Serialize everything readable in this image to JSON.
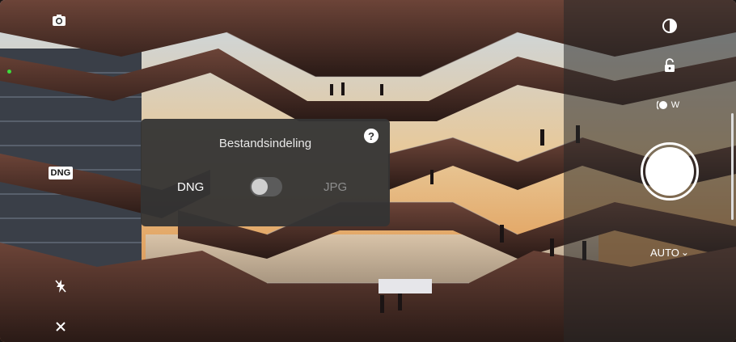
{
  "camera": {
    "raw_format_badge": "DNG",
    "flash_icon": "flash-off-icon",
    "close_icon": "close-icon",
    "switch_camera_icon": "switch-camera-icon",
    "lens_icon": "lens-filter-icon",
    "lock_icon": "unlock-icon",
    "wb_icon": "white-balance-icon",
    "wb_label": "W",
    "auto_label": "AUTO",
    "auto_chevron": "⌄"
  },
  "dialog": {
    "title": "Bestandsindeling",
    "help_glyph": "?",
    "option_left": "DNG",
    "option_right": "JPG"
  },
  "colors": {
    "accent_indicator": "#3cdc3c",
    "panel_bg": "#343434"
  }
}
